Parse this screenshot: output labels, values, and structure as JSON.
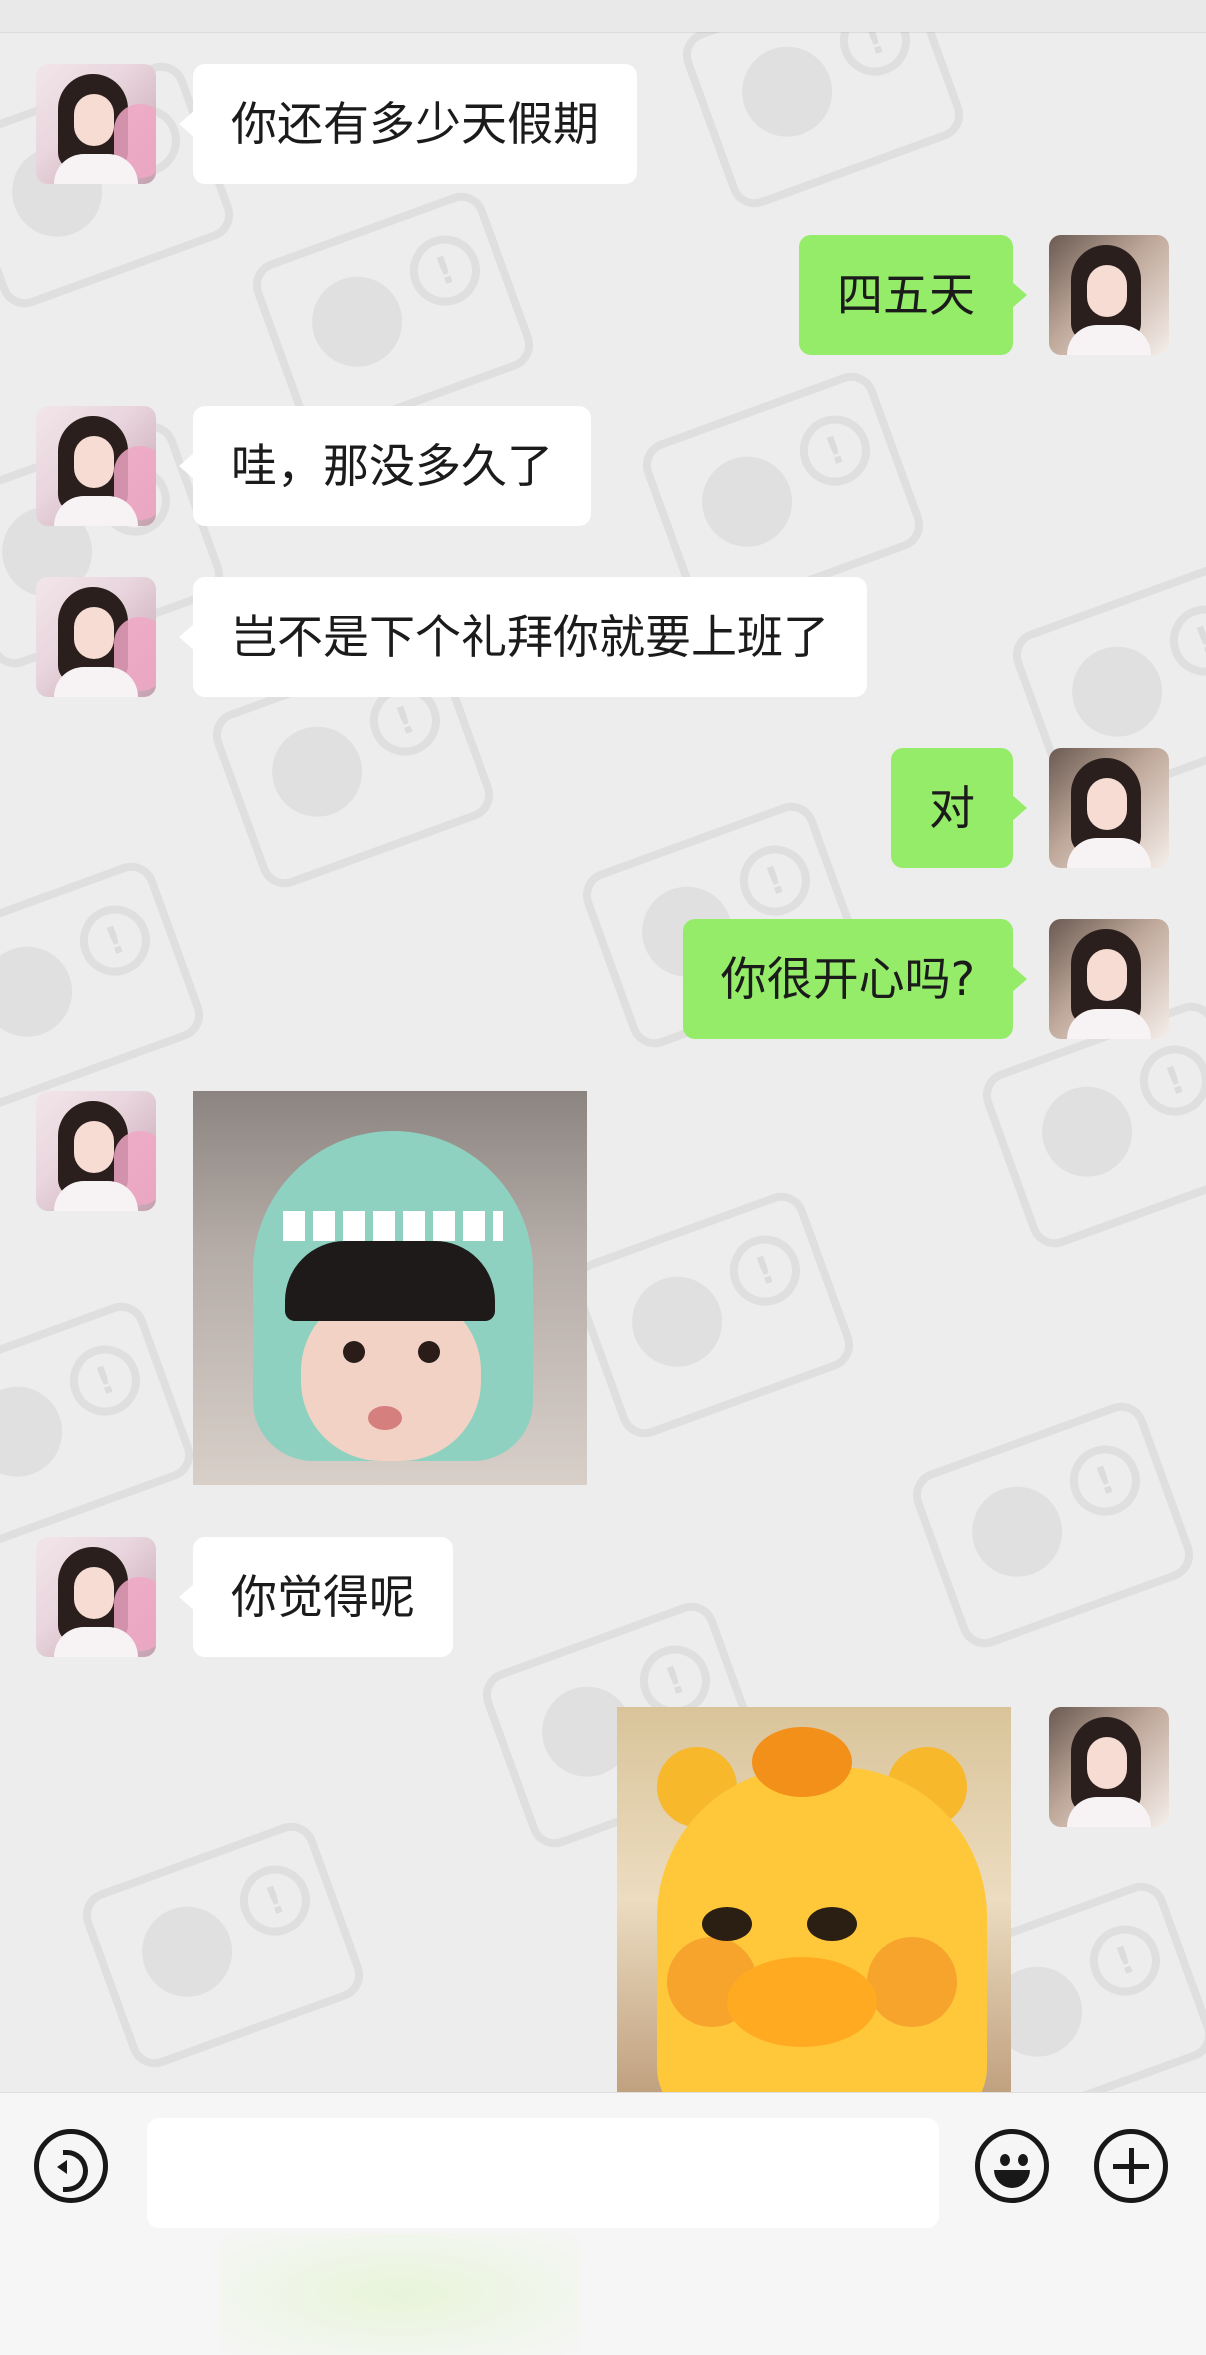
{
  "messages": [
    {
      "side": "in",
      "type": "text",
      "text": "你还有多少天假期"
    },
    {
      "side": "out",
      "type": "text",
      "text": "四五天"
    },
    {
      "side": "in",
      "type": "text",
      "text": "哇，那没多久了"
    },
    {
      "side": "in",
      "type": "text",
      "text": "岂不是下个礼拜你就要上班了"
    },
    {
      "side": "out",
      "type": "text",
      "text": "对"
    },
    {
      "side": "out",
      "type": "text",
      "text": "你很开心吗?"
    },
    {
      "side": "in",
      "type": "sticker",
      "sticker": "kid-in-dinosaur-hood-pouting"
    },
    {
      "side": "in",
      "type": "text",
      "text": "你觉得呢"
    },
    {
      "side": "out",
      "type": "sticker",
      "sticker": "grumpy-yellow-bear-with-orange"
    }
  ],
  "input_bar": {
    "text_value": "",
    "icons": [
      "voice-icon",
      "emoji-icon",
      "plus-icon"
    ]
  }
}
